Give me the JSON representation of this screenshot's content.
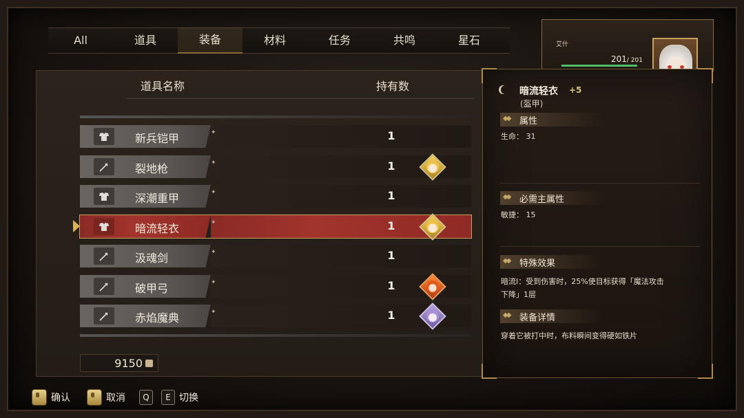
{
  "tabs": [
    "All",
    "道具",
    "装备",
    "材料",
    "任务",
    "共鸣",
    "星石"
  ],
  "active_tab": "装备",
  "columns": {
    "name": "道具名称",
    "count": "持有数"
  },
  "items": [
    {
      "name": "新兵铠甲",
      "count": "1",
      "icon": "armor-icon",
      "owner": null
    },
    {
      "name": "裂地枪",
      "count": "1",
      "icon": "sword-icon",
      "owner": "yellow"
    },
    {
      "name": "深潮重甲",
      "count": "1",
      "icon": "armor-icon",
      "owner": null
    },
    {
      "name": "暗流轻衣",
      "count": "1",
      "icon": "armor-icon",
      "owner": "yellow",
      "selected": true
    },
    {
      "name": "汲魂剑",
      "count": "1",
      "icon": "sword-icon",
      "owner": null
    },
    {
      "name": "破甲弓",
      "count": "1",
      "icon": "sword-icon",
      "owner": "orange"
    },
    {
      "name": "赤焰魔典",
      "count": "1",
      "icon": "sword-icon",
      "owner": "purple"
    }
  ],
  "currency": {
    "amount": "9150"
  },
  "character": {
    "name": "艾什",
    "hp": "201",
    "hp_max": "/ 201",
    "hp_fraction": 1.0
  },
  "detail": {
    "title": "暗流轻衣",
    "plus": "+5",
    "type": "(盔甲)",
    "attributes_heading": "属性",
    "attributes_text": "生命： 31",
    "required_heading": "必需主属性",
    "required_text": "敏捷： 15",
    "special_heading": "特殊效果",
    "special_text_1": "暗流Ⅰ：受到伤害时，25%使目标获得「魔法攻击",
    "special_text_2": "下降」1层",
    "details_heading": "装备详情",
    "details_text": "穿着它被打中时，布料瞬间变得硬如铁片"
  },
  "footer": {
    "confirm": "确认",
    "cancel": "取消",
    "key_q": "Q",
    "key_e": "E",
    "switch": "切换"
  }
}
